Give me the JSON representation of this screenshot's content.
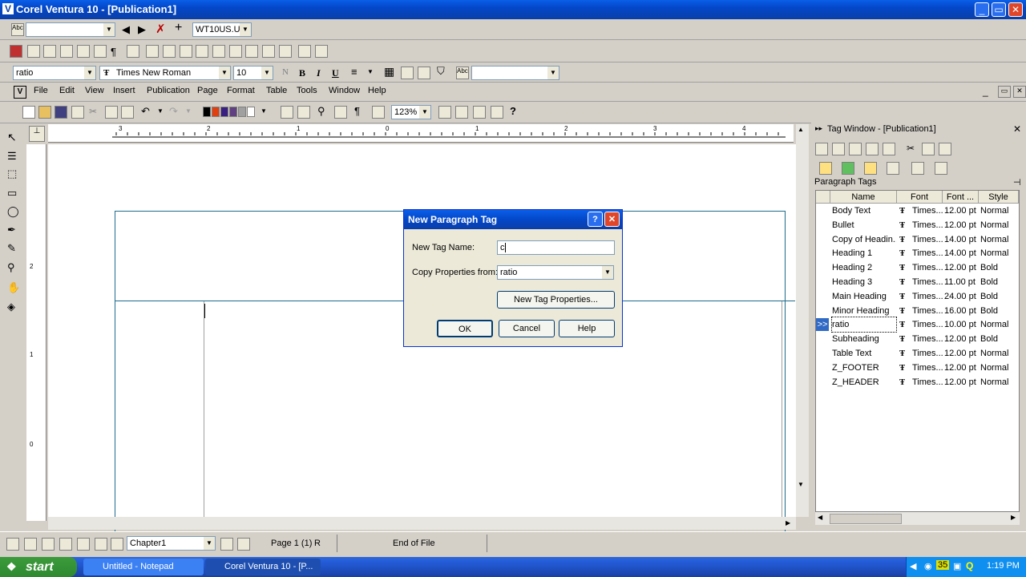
{
  "window": {
    "title": "Corel Ventura 10 - [Publication1]",
    "min": "_",
    "max": "▭",
    "close": "✕"
  },
  "toolbar1": {
    "spell_combo": "",
    "font_combo": "WT10US.U'"
  },
  "format_bar": {
    "tag": "ratio",
    "font": "Times New Roman",
    "size": "10",
    "n": "N",
    "bold": "B",
    "italic": "I",
    "underline": "U"
  },
  "menu": [
    "File",
    "Edit",
    "View",
    "Insert",
    "Publication",
    "Page",
    "Format",
    "Table",
    "Tools",
    "Window",
    "Help"
  ],
  "standard": {
    "zoom": "123%"
  },
  "colors": {
    "swatches": [
      "#000000",
      "#e04010",
      "#3a2080",
      "#604080",
      "#a0a0a0",
      "#ffffff"
    ]
  },
  "dialog": {
    "title": "New Paragraph Tag",
    "help_icon": "?",
    "tag_name_label": "New Tag Name:",
    "tag_name_value": "c",
    "copy_label": "Copy Properties from:",
    "copy_value": "ratio",
    "props_button": "New Tag Properties...",
    "ok": "OK",
    "cancel": "Cancel",
    "help": "Help"
  },
  "tagwindow": {
    "title": "Tag Window - [Publication1]",
    "section": "Paragraph Tags",
    "headers": [
      "Name",
      "Font",
      "Font ...",
      "Style"
    ],
    "selected_marker": ">>",
    "rows": [
      {
        "name": "Body Text",
        "font": "Times...",
        "size": "12.00 pt",
        "style": "Normal"
      },
      {
        "name": "Bullet",
        "font": "Times...",
        "size": "12.00 pt",
        "style": "Normal"
      },
      {
        "name": "Copy of Headin...",
        "font": "Times...",
        "size": "14.00 pt",
        "style": "Normal"
      },
      {
        "name": "Heading 1",
        "font": "Times...",
        "size": "14.00 pt",
        "style": "Normal"
      },
      {
        "name": "Heading 2",
        "font": "Times...",
        "size": "12.00 pt",
        "style": "Bold"
      },
      {
        "name": "Heading 3",
        "font": "Times...",
        "size": "11.00 pt",
        "style": "Bold"
      },
      {
        "name": "Main Heading",
        "font": "Times...",
        "size": "24.00 pt",
        "style": "Bold"
      },
      {
        "name": "Minor Heading",
        "font": "Times...",
        "size": "16.00 pt",
        "style": "Bold"
      },
      {
        "name": "ratio",
        "font": "Times...",
        "size": "10.00 pt",
        "style": "Normal"
      },
      {
        "name": "Subheading",
        "font": "Times...",
        "size": "12.00 pt",
        "style": "Bold"
      },
      {
        "name": "Table Text",
        "font": "Times...",
        "size": "12.00 pt",
        "style": "Normal"
      },
      {
        "name": "Z_FOOTER",
        "font": "Times...",
        "size": "12.00 pt",
        "style": "Normal"
      },
      {
        "name": "Z_HEADER",
        "font": "Times...",
        "size": "12.00 pt",
        "style": "Normal"
      }
    ]
  },
  "status": {
    "chapter": "Chapter1",
    "page": "Page 1 (1)",
    "r": "R",
    "eof": "End of File"
  },
  "taskbar": {
    "start": "start",
    "task1": "Untitled - Notepad",
    "task2": "Corel Ventura 10 - [P...",
    "tray_num": "35",
    "clock": "1:19 PM"
  },
  "ruler": {
    "labels": [
      "3",
      "2",
      "1",
      "0",
      "1",
      "2",
      "3",
      "4"
    ],
    "vlabels": [
      "2",
      "1",
      "0"
    ]
  }
}
